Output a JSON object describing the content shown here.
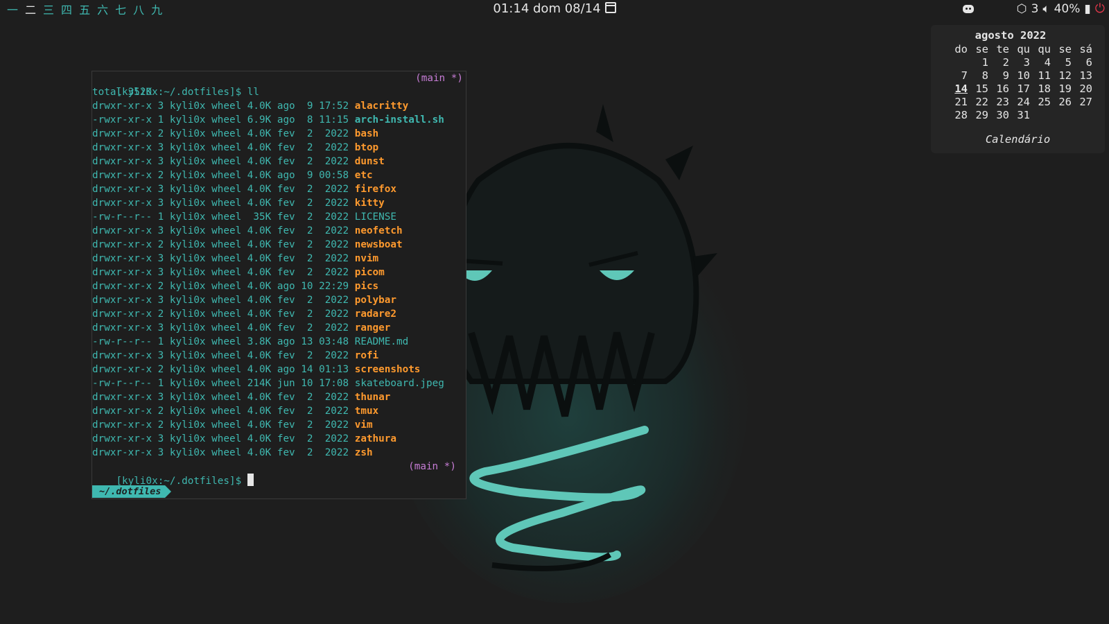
{
  "topbar": {
    "workspaces": [
      "一",
      "二",
      "三",
      "四",
      "五",
      "六",
      "七",
      "八",
      "九"
    ],
    "active_workspace": 1,
    "clock": "01:14  dom 08/14",
    "tray": {
      "network_count": "3",
      "volume": "40%"
    }
  },
  "terminal": {
    "command_prompt": "[kyli0x:~/.dotfiles]$ ll",
    "git_status": "(main *)",
    "total": "total 352K",
    "rows": [
      {
        "meta": "drwxr-xr-x 3 kyli0x wheel 4.0K ago  9 17:52 ",
        "name": "alacritty",
        "kind": "dir"
      },
      {
        "meta": "-rwxr-xr-x 1 kyli0x wheel 6.9K ago  8 11:15 ",
        "name": "arch-install.sh",
        "kind": "exe"
      },
      {
        "meta": "drwxr-xr-x 2 kyli0x wheel 4.0K fev  2  2022 ",
        "name": "bash",
        "kind": "dir"
      },
      {
        "meta": "drwxr-xr-x 3 kyli0x wheel 4.0K fev  2  2022 ",
        "name": "btop",
        "kind": "dir"
      },
      {
        "meta": "drwxr-xr-x 3 kyli0x wheel 4.0K fev  2  2022 ",
        "name": "dunst",
        "kind": "dir"
      },
      {
        "meta": "drwxr-xr-x 2 kyli0x wheel 4.0K ago  9 00:58 ",
        "name": "etc",
        "kind": "dir"
      },
      {
        "meta": "drwxr-xr-x 3 kyli0x wheel 4.0K fev  2  2022 ",
        "name": "firefox",
        "kind": "dir"
      },
      {
        "meta": "drwxr-xr-x 3 kyli0x wheel 4.0K fev  2  2022 ",
        "name": "kitty",
        "kind": "dir"
      },
      {
        "meta": "-rw-r--r-- 1 kyli0x wheel  35K fev  2  2022 ",
        "name": "LICENSE",
        "kind": "file"
      },
      {
        "meta": "drwxr-xr-x 3 kyli0x wheel 4.0K fev  2  2022 ",
        "name": "neofetch",
        "kind": "dir"
      },
      {
        "meta": "drwxr-xr-x 2 kyli0x wheel 4.0K fev  2  2022 ",
        "name": "newsboat",
        "kind": "dir"
      },
      {
        "meta": "drwxr-xr-x 3 kyli0x wheel 4.0K fev  2  2022 ",
        "name": "nvim",
        "kind": "dir"
      },
      {
        "meta": "drwxr-xr-x 3 kyli0x wheel 4.0K fev  2  2022 ",
        "name": "picom",
        "kind": "dir"
      },
      {
        "meta": "drwxr-xr-x 2 kyli0x wheel 4.0K ago 10 22:29 ",
        "name": "pics",
        "kind": "dir"
      },
      {
        "meta": "drwxr-xr-x 3 kyli0x wheel 4.0K fev  2  2022 ",
        "name": "polybar",
        "kind": "dir"
      },
      {
        "meta": "drwxr-xr-x 2 kyli0x wheel 4.0K fev  2  2022 ",
        "name": "radare2",
        "kind": "dir"
      },
      {
        "meta": "drwxr-xr-x 3 kyli0x wheel 4.0K fev  2  2022 ",
        "name": "ranger",
        "kind": "dir"
      },
      {
        "meta": "-rw-r--r-- 1 kyli0x wheel 3.8K ago 13 03:48 ",
        "name": "README.md",
        "kind": "file"
      },
      {
        "meta": "drwxr-xr-x 3 kyli0x wheel 4.0K fev  2  2022 ",
        "name": "rofi",
        "kind": "dir"
      },
      {
        "meta": "drwxr-xr-x 2 kyli0x wheel 4.0K ago 14 01:13 ",
        "name": "screenshots",
        "kind": "dir"
      },
      {
        "meta": "-rw-r--r-- 1 kyli0x wheel 214K jun 10 17:08 ",
        "name": "skateboard.jpeg",
        "kind": "file"
      },
      {
        "meta": "drwxr-xr-x 3 kyli0x wheel 4.0K fev  2  2022 ",
        "name": "thunar",
        "kind": "dir"
      },
      {
        "meta": "drwxr-xr-x 2 kyli0x wheel 4.0K fev  2  2022 ",
        "name": "tmux",
        "kind": "dir"
      },
      {
        "meta": "drwxr-xr-x 2 kyli0x wheel 4.0K fev  2  2022 ",
        "name": "vim",
        "kind": "dir"
      },
      {
        "meta": "drwxr-xr-x 3 kyli0x wheel 4.0K fev  2  2022 ",
        "name": "zathura",
        "kind": "dir"
      },
      {
        "meta": "drwxr-xr-x 3 kyli0x wheel 4.0K fev  2  2022 ",
        "name": "zsh",
        "kind": "dir"
      }
    ],
    "prompt": "[kyli0x:~/.dotfiles]$ ",
    "path_segment": "~/.dotfiles"
  },
  "calendar": {
    "title": "agosto 2022",
    "weekdays": [
      "do",
      "se",
      "te",
      "qu",
      "qu",
      "se",
      "sá"
    ],
    "weeks": [
      [
        "",
        "1",
        "2",
        "3",
        "4",
        "5",
        "6"
      ],
      [
        "7",
        "8",
        "9",
        "10",
        "11",
        "12",
        "13"
      ],
      [
        "14",
        "15",
        "16",
        "17",
        "18",
        "19",
        "20"
      ],
      [
        "21",
        "22",
        "23",
        "24",
        "25",
        "26",
        "27"
      ],
      [
        "28",
        "29",
        "30",
        "31",
        "",
        "",
        ""
      ]
    ],
    "today": "14",
    "footer": "Calendário"
  },
  "colors": {
    "accent": "#3fb8b0",
    "directory": "#ff9a2e",
    "git": "#c77dd6",
    "power": "#e0374a"
  }
}
